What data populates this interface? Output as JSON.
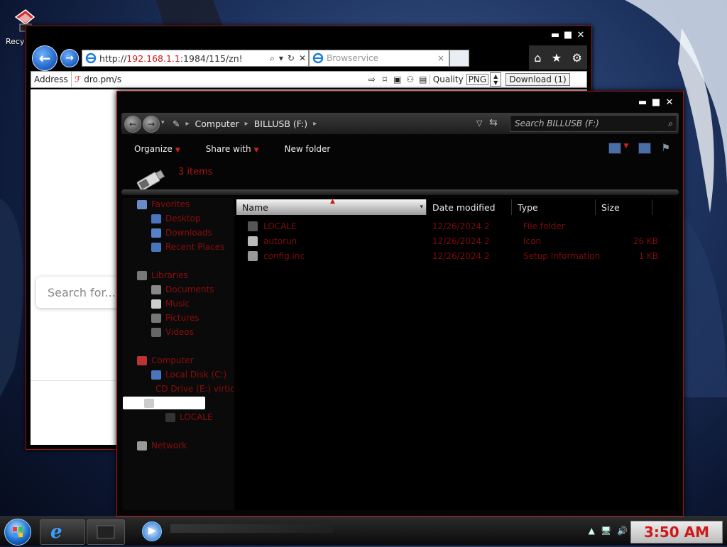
{
  "desktop": {
    "recycle_label": "Recy"
  },
  "browser": {
    "url_prefix": "http://",
    "url_host": "192.168.1.1",
    "url_rest": ":1984/115/zn!",
    "tab_title": "Browservice",
    "tab_close": "×",
    "address_label": "Address",
    "address_value": "dro.pm/s",
    "quality_label": "Quality",
    "quality_value": "PNG",
    "download_label": "Download (1)",
    "search_placeholder": "Search for..."
  },
  "explorer": {
    "breadcrumb": [
      "Computer",
      "BILLUSB (F:)"
    ],
    "search_placeholder": "Search BILLUSB (F:)",
    "toolbar": {
      "organize": "Organize",
      "share_with": "Share with",
      "new_folder": "New folder"
    },
    "item_count": "3 items",
    "nav": [
      {
        "label": "Favorites",
        "indent": 0
      },
      {
        "label": "Desktop",
        "indent": 1
      },
      {
        "label": "Downloads",
        "indent": 1
      },
      {
        "label": "Recent Places",
        "indent": 1
      },
      {
        "label": "Libraries",
        "indent": 0
      },
      {
        "label": "Documents",
        "indent": 1
      },
      {
        "label": "Music",
        "indent": 1
      },
      {
        "label": "Pictures",
        "indent": 1
      },
      {
        "label": "Videos",
        "indent": 1
      },
      {
        "label": "Computer",
        "indent": 0
      },
      {
        "label": "Local Disk (C:)",
        "indent": 1
      },
      {
        "label": "CD Drive (E:) virtio-w",
        "indent": 1
      },
      {
        "label": "",
        "indent": 1
      },
      {
        "label": "LOCALE",
        "indent": 2
      },
      {
        "label": "Network",
        "indent": 0
      }
    ],
    "columns": {
      "name": "Name",
      "date": "Date modified",
      "type": "Type",
      "size": "Size"
    },
    "files": [
      {
        "name": "LOCALE",
        "date": "12/26/2024 2",
        "type": "File folder",
        "size": ""
      },
      {
        "name": "autorun",
        "date": "12/26/2024 2",
        "type": "Icon",
        "size": "26 KB"
      },
      {
        "name": "config.inc",
        "date": "12/26/2024 2",
        "type": "Setup Information",
        "size": "1 KB"
      }
    ]
  },
  "taskbar": {
    "clock": "3:50 AM"
  },
  "colors": {
    "accent": "#b01010",
    "text_red": "#7d0b0b",
    "ie_blue": "#1d5fc1"
  }
}
